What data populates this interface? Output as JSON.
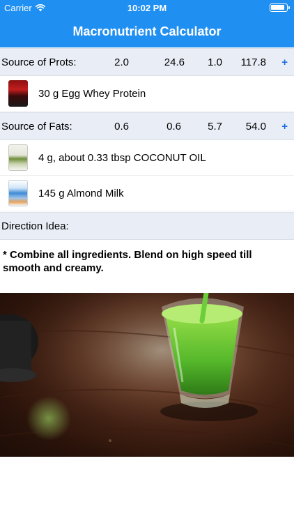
{
  "status_bar": {
    "carrier": "Carrier",
    "time": "10:02 PM"
  },
  "header": {
    "title": "Macronutrient Calculator",
    "color": "#1f8ff2"
  },
  "proteins": {
    "label": "Source of Prots:",
    "values": [
      "2.0",
      "24.6",
      "1.0",
      "117.8"
    ],
    "add": "+",
    "items": [
      {
        "text": "30 g  Egg Whey Protein",
        "icon": "protein-tub-image"
      }
    ]
  },
  "fats": {
    "label": "Source of Fats:",
    "values": [
      "0.6",
      "0.6",
      "5.7",
      "54.0"
    ],
    "add": "+",
    "items": [
      {
        "text": "4 g, about 0.33 tbsp  COCONUT OIL",
        "icon": "coconut-oil-jar-image"
      },
      {
        "text": "145 g  Almond Milk",
        "icon": "almond-milk-carton-image"
      }
    ]
  },
  "direction": {
    "label": "Direction Idea:",
    "text": "* Combine all ingredients. Blend on high speed till smooth and creamy."
  },
  "colors": {
    "section_bg": "#e9eef6",
    "accent": "#1f6be0"
  }
}
